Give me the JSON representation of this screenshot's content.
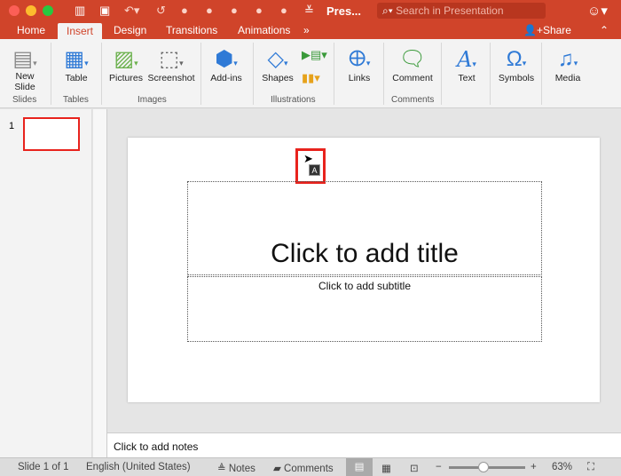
{
  "window": {
    "title": "Pres...",
    "search_placeholder": "Search in Presentation"
  },
  "tabs": [
    "Home",
    "Insert",
    "Design",
    "Transitions",
    "Animations"
  ],
  "tabs_more": "»",
  "share": "Share",
  "ribbon": {
    "buttons": [
      {
        "label": "New\nSlide",
        "icon": "new-slide-icon"
      },
      {
        "label": "Table",
        "icon": "table-icon"
      },
      {
        "label": "Pictures",
        "icon": "pictures-icon"
      },
      {
        "label": "Screenshot",
        "icon": "screenshot-icon"
      },
      {
        "label": "Add-ins",
        "icon": "add-ins-icon"
      },
      {
        "label": "Shapes",
        "icon": "shapes-icon"
      },
      {
        "label": "Links",
        "icon": "links-icon"
      },
      {
        "label": "Comment",
        "icon": "comment-icon"
      },
      {
        "label": "Text",
        "icon": "text-icon"
      },
      {
        "label": "Symbols",
        "icon": "symbols-icon"
      },
      {
        "label": "Media",
        "icon": "media-icon"
      }
    ],
    "groups": [
      "Slides",
      "Tables",
      "Images",
      "Illustrations",
      "Comments"
    ]
  },
  "thumbnails": {
    "number": "1"
  },
  "slide": {
    "title_placeholder": "Click to add title",
    "subtitle_placeholder": "Click to add subtitle",
    "cursor_badge": "A"
  },
  "notes": "Click to add notes",
  "status": {
    "slide": "Slide 1 of 1",
    "language": "English (United States)",
    "notes": "Notes",
    "comments": "Comments",
    "zoom": "63%",
    "zoom_fraction": 0.45
  },
  "colors": {
    "accent": "#d0442a",
    "highlight": "#e8231d"
  }
}
